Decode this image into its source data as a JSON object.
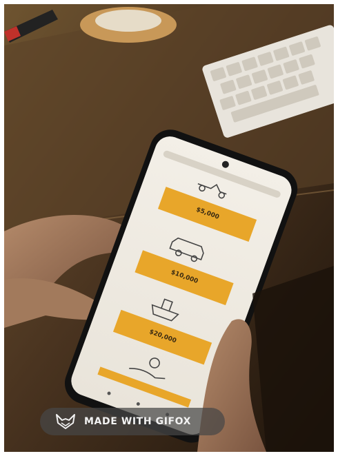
{
  "watermark": {
    "text": "MADE WITH GIFOX",
    "icon": "fox-icon"
  },
  "phone_screen": {
    "buttons": [
      {
        "label": "$5,000",
        "icon": "car-keys-icon"
      },
      {
        "label": "$10,000",
        "icon": "car-icon"
      },
      {
        "label": "$20,000",
        "icon": "ship-icon"
      },
      {
        "label": "",
        "icon": "hand-coin-icon"
      }
    ],
    "accent": "#e8a62a"
  }
}
